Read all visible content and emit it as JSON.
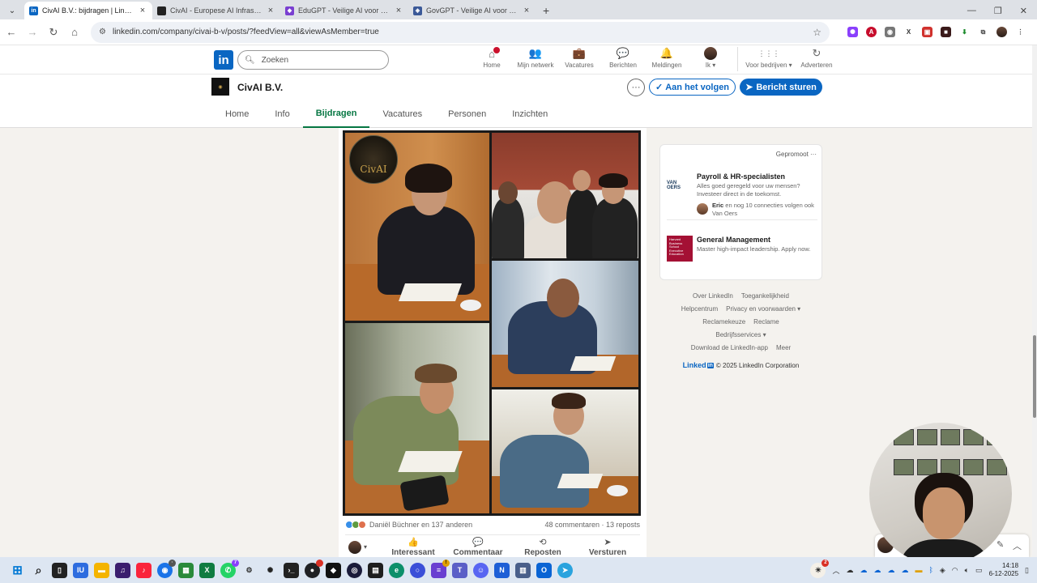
{
  "browser": {
    "tabs": [
      {
        "title": "CivAI B.V.: bijdragen | LinkedIn",
        "active": true,
        "favicon_color": "#0a66c2",
        "favicon_glyph": "in"
      },
      {
        "title": "CivAI - Europese AI Infrastructu",
        "active": false,
        "favicon_color": "#222222",
        "favicon_glyph": ""
      },
      {
        "title": "EduGPT - Veilige AI voor het Ond",
        "active": false,
        "favicon_color": "#7a3fd1",
        "favicon_glyph": "◆"
      },
      {
        "title": "GovGPT - Veilige AI voor de Ned",
        "active": false,
        "favicon_color": "#3b5998",
        "favicon_glyph": "◈"
      }
    ],
    "url": "linkedin.com/company/civai-b-v/posts/?feedView=all&viewAsMember=true"
  },
  "linkedin": {
    "search_placeholder": "Zoeken",
    "nav": [
      {
        "label": "Home",
        "icon": "home-icon",
        "glyph": "⌂"
      },
      {
        "label": "Mijn netwerk",
        "icon": "network-icon",
        "glyph": "👥"
      },
      {
        "label": "Vacatures",
        "icon": "briefcase-icon",
        "glyph": "💼"
      },
      {
        "label": "Berichten",
        "icon": "messaging-icon",
        "glyph": "💬"
      },
      {
        "label": "Meldingen",
        "icon": "bell-icon",
        "glyph": "🔔"
      },
      {
        "label": "Ik ▾",
        "icon": "avatar",
        "glyph": ""
      }
    ],
    "nav_business": {
      "label": "Voor bedrijven ▾",
      "glyph": "⋮⋮⋮"
    },
    "nav_advertise": {
      "label": "Adverteren",
      "glyph": "↻"
    }
  },
  "company": {
    "name": "CivAI B.V.",
    "follow_label": "Aan het volgen",
    "message_label": "Bericht sturen",
    "tabs": [
      "Home",
      "Info",
      "Bijdragen",
      "Vacatures",
      "Personen",
      "Inzichten"
    ],
    "active_tab": "Bijdragen"
  },
  "post": {
    "image_badge_text": "CivAI",
    "reactions_text": "Daniël Büchner en 137 anderen",
    "comments_reposts_text": "48 commentaren · 13 reposts",
    "actions": [
      {
        "label": "Interessant",
        "glyph": "👍"
      },
      {
        "label": "Commentaar",
        "glyph": "💬"
      },
      {
        "label": "Reposten",
        "glyph": "⟲"
      },
      {
        "label": "Versturen",
        "glyph": "➤"
      }
    ]
  },
  "ads": {
    "promoted_label": "Gepromoot ···",
    "items": [
      {
        "logo_text": "VAN OERS",
        "title": "Payroll & HR-specialisten",
        "description": "Alles goed geregeld voor uw mensen? Investeer direct in de toekomst.",
        "social_name": "Eric",
        "social_text": " en nog 10 connecties volgen ook Van Oers"
      },
      {
        "logo_text": "Harvard Business School Executive Education",
        "title": "General Management",
        "description": "Master high-impact leadership. Apply now."
      }
    ]
  },
  "footer": {
    "rows": [
      [
        "Over LinkedIn",
        "Toegankelijkheid"
      ],
      [
        "Helpcentrum",
        "Privacy en voorwaarden ▾"
      ],
      [
        "Reclamekeuze",
        "Reclame"
      ],
      [
        "Bedrijfsservices ▾"
      ],
      [
        "Download de LinkedIn-app",
        "Meer"
      ]
    ],
    "brand": "Linked",
    "brand_in": "in",
    "copyright": "© 2025 LinkedIn Corporation"
  },
  "taskbar": {
    "time": "14:18",
    "date": "6-12-2025"
  },
  "colors": {
    "linkedin_blue": "#0a66c2",
    "active_tab_green": "#057642",
    "notification_red": "#cb112d"
  }
}
